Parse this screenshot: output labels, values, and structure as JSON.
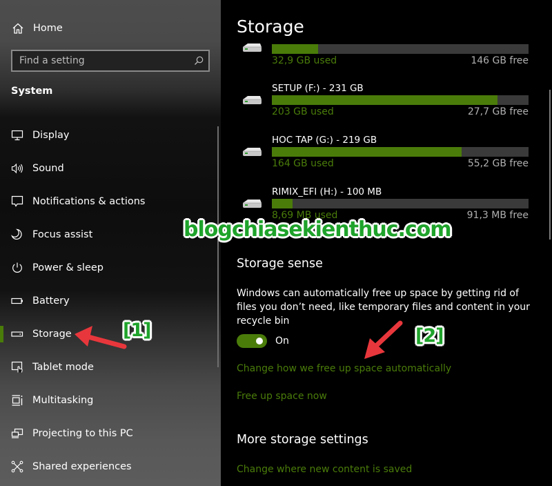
{
  "sidebar": {
    "home_label": "Home",
    "search": {
      "placeholder": "Find a setting",
      "value": ""
    },
    "section_title": "System",
    "items": [
      {
        "label": "Display",
        "icon": "monitor-icon",
        "selected": false
      },
      {
        "label": "Sound",
        "icon": "speaker-icon",
        "selected": false
      },
      {
        "label": "Notifications & actions",
        "icon": "notification-icon",
        "selected": false
      },
      {
        "label": "Focus assist",
        "icon": "moon-icon",
        "selected": false
      },
      {
        "label": "Power & sleep",
        "icon": "power-icon",
        "selected": false
      },
      {
        "label": "Battery",
        "icon": "battery-icon",
        "selected": false
      },
      {
        "label": "Storage",
        "icon": "storage-icon",
        "selected": true
      },
      {
        "label": "Tablet mode",
        "icon": "tablet-mode-icon",
        "selected": false
      },
      {
        "label": "Multitasking",
        "icon": "multitasking-icon",
        "selected": false
      },
      {
        "label": "Projecting to this PC",
        "icon": "projecting-icon",
        "selected": false
      },
      {
        "label": "Shared experiences",
        "icon": "shared-experiences-icon",
        "selected": false
      }
    ]
  },
  "main": {
    "title": "Storage",
    "drives": [
      {
        "name": "",
        "used": "32,9 GB used",
        "free": "146 GB free",
        "used_fraction": 0.18
      },
      {
        "name": "SETUP (F:) - 231 GB",
        "used": "203 GB used",
        "free": "27,7 GB free",
        "used_fraction": 0.88
      },
      {
        "name": "HOC TAP (G:) - 219 GB",
        "used": "164 GB used",
        "free": "55,2 GB free",
        "used_fraction": 0.74
      },
      {
        "name": "RIMIX_EFI (H:) - 100 MB",
        "used": "8,69 MB used",
        "free": "91,3 MB free",
        "used_fraction": 0.08
      }
    ],
    "storage_sense": {
      "title": "Storage sense",
      "description": "Windows can automatically free up space by getting rid of files you don’t need, like temporary files and content in your recycle bin",
      "toggle_state": "On",
      "toggle_on": true,
      "link_change": "Change how we free up space automatically",
      "link_free_now": "Free up space now"
    },
    "more_settings": {
      "title": "More storage settings",
      "link_change_location": "Change where new content is saved"
    }
  },
  "annotations": {
    "watermark": "blogchiasekienthuc.com",
    "step1": "[1]",
    "step2": "[2]"
  },
  "colors": {
    "accent": "#4a7c0a",
    "bar_track": "#3a3a3a",
    "annotation_green": "#1fa32b",
    "arrow_red": "#e8373c"
  }
}
